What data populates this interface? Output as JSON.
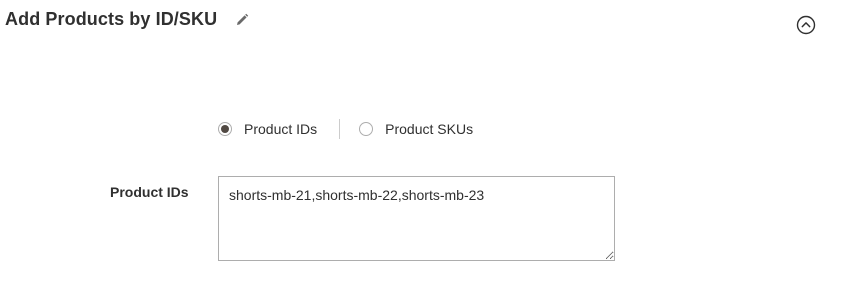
{
  "section": {
    "title": "Add Products by ID/SKU"
  },
  "radio_group": {
    "options": [
      {
        "label": "Product IDs",
        "selected": true
      },
      {
        "label": "Product SKUs",
        "selected": false
      }
    ]
  },
  "product_ids_field": {
    "label": "Product IDs",
    "value": "shorts-mb-21,shorts-mb-22,shorts-mb-23"
  },
  "colors": {
    "text": "#303030",
    "border": "#adadad",
    "radio_checked": "#514943"
  },
  "icons": {
    "edit": "pencil-icon",
    "collapse": "chevron-up-circle-icon"
  }
}
